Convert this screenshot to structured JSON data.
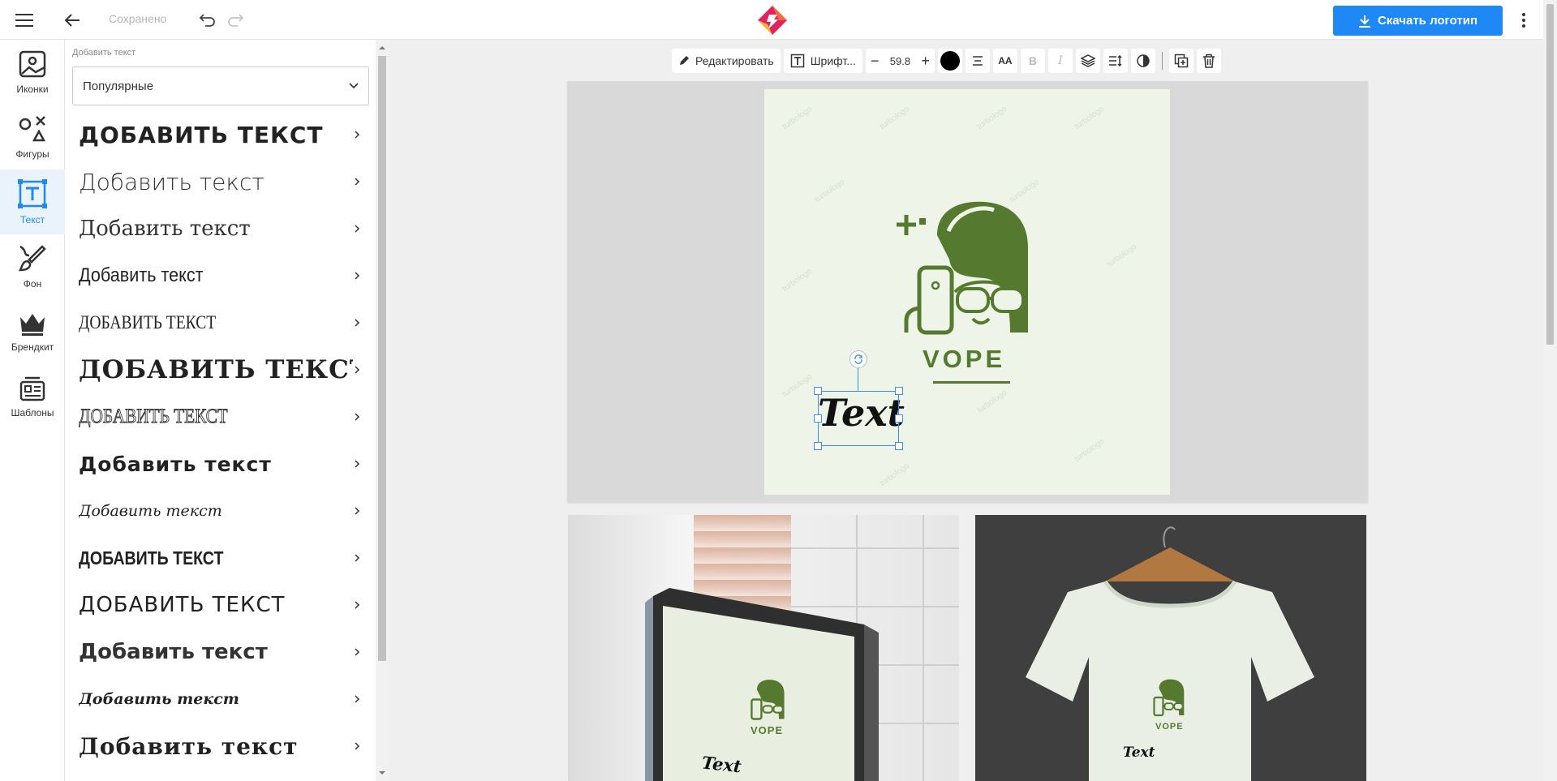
{
  "header": {
    "saved_status": "Сохранено",
    "download_label": "Скачать логотип",
    "accent_color": "#1e88f5"
  },
  "rail": {
    "items": [
      {
        "label": "Иконки",
        "icon": "image-icon",
        "active": false
      },
      {
        "label": "Фигуры",
        "icon": "shapes-icon",
        "active": false
      },
      {
        "label": "Текст",
        "icon": "text-icon",
        "active": true
      },
      {
        "label": "Фон",
        "icon": "brush-icon",
        "active": false
      },
      {
        "label": "Брендкит",
        "icon": "crown-icon",
        "active": false
      },
      {
        "label": "Шаблоны",
        "icon": "templates-icon",
        "active": false
      }
    ]
  },
  "panel": {
    "title": "Добавить текст",
    "category_select": "Популярные",
    "font_items": [
      "ДОБАВИТЬ ТЕКСТ",
      "Добавить текст",
      "Добавить текст",
      "Добавить текст",
      "ДОБАВИТЬ ТЕКСТ",
      "ДОБАВИТЬ ТЕКСТ",
      "ДОБАВИТЬ ТЕКСТ",
      "Добавить текст",
      "Добавить текст",
      "ДОБАВИТЬ ТЕКСТ",
      "ДОБАВИТЬ ТЕКСТ",
      "Добавить текст",
      "Добавить текст",
      "Добавить текст"
    ]
  },
  "toolbar": {
    "edit_label": "Редактировать",
    "font_label": "Шрифт...",
    "font_size": "59.8",
    "case_label": "AA",
    "bold_label": "B",
    "italic_label": "I",
    "text_color": "#000000"
  },
  "canvas": {
    "brand_name": "VOPE",
    "selected_text": "Text",
    "watermark": "turbologo",
    "logo_color": "#557a2f",
    "background_color": "#eef5e8"
  },
  "mockups": {
    "sign_brand": "VOPE",
    "sign_text": "Text",
    "shirt_brand": "VOPE",
    "shirt_text": "Text"
  }
}
